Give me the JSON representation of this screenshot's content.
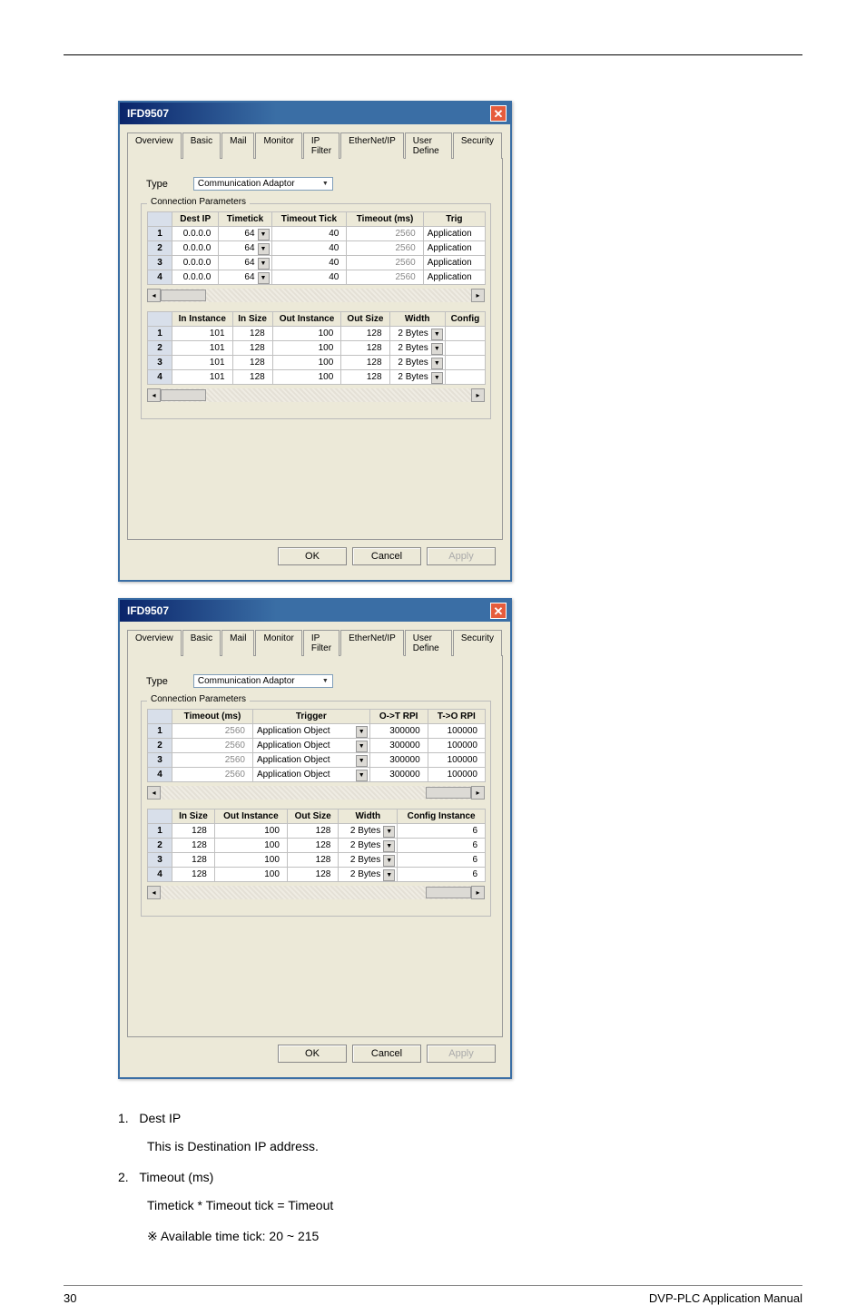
{
  "window_title": "IFD9507",
  "tabs": [
    "Overview",
    "Basic",
    "Mail",
    "Monitor",
    "IP Filter",
    "EtherNet/IP",
    "User Define",
    "Security"
  ],
  "active_tab": "EtherNet/IP",
  "type_label": "Type",
  "type_value": "Communication Adaptor",
  "group_label": "Connection Parameters",
  "dialog1": {
    "table1": {
      "headers": [
        "Dest IP",
        "Timetick",
        "Timeout Tick",
        "Timeout (ms)",
        "Trig"
      ],
      "rows": [
        {
          "n": "1",
          "dest": "0.0.0.0",
          "tt": "64",
          "ttk": "40",
          "toms": "2560",
          "trig": "Application"
        },
        {
          "n": "2",
          "dest": "0.0.0.0",
          "tt": "64",
          "ttk": "40",
          "toms": "2560",
          "trig": "Application"
        },
        {
          "n": "3",
          "dest": "0.0.0.0",
          "tt": "64",
          "ttk": "40",
          "toms": "2560",
          "trig": "Application"
        },
        {
          "n": "4",
          "dest": "0.0.0.0",
          "tt": "64",
          "ttk": "40",
          "toms": "2560",
          "trig": "Application"
        }
      ]
    },
    "table2": {
      "headers": [
        "In Instance",
        "In Size",
        "Out Instance",
        "Out Size",
        "Width",
        "Config"
      ],
      "rows": [
        {
          "n": "1",
          "ii": "101",
          "is": "128",
          "oi": "100",
          "os": "128",
          "w": "2 Bytes",
          "c": ""
        },
        {
          "n": "2",
          "ii": "101",
          "is": "128",
          "oi": "100",
          "os": "128",
          "w": "2 Bytes",
          "c": ""
        },
        {
          "n": "3",
          "ii": "101",
          "is": "128",
          "oi": "100",
          "os": "128",
          "w": "2 Bytes",
          "c": ""
        },
        {
          "n": "4",
          "ii": "101",
          "is": "128",
          "oi": "100",
          "os": "128",
          "w": "2 Bytes",
          "c": ""
        }
      ]
    }
  },
  "dialog2": {
    "table1": {
      "headers": [
        "Timeout (ms)",
        "Trigger",
        "O->T RPI",
        "T->O RPI"
      ],
      "rows": [
        {
          "n": "1",
          "toms": "2560",
          "trig": "Application Object",
          "ot": "300000",
          "to": "100000"
        },
        {
          "n": "2",
          "toms": "2560",
          "trig": "Application Object",
          "ot": "300000",
          "to": "100000"
        },
        {
          "n": "3",
          "toms": "2560",
          "trig": "Application Object",
          "ot": "300000",
          "to": "100000"
        },
        {
          "n": "4",
          "toms": "2560",
          "trig": "Application Object",
          "ot": "300000",
          "to": "100000"
        }
      ]
    },
    "table2": {
      "headers": [
        "In Size",
        "Out Instance",
        "Out Size",
        "Width",
        "Config Instance"
      ],
      "rows": [
        {
          "n": "1",
          "is": "128",
          "oi": "100",
          "os": "128",
          "w": "2 Bytes",
          "ci": "6"
        },
        {
          "n": "2",
          "is": "128",
          "oi": "100",
          "os": "128",
          "w": "2 Bytes",
          "ci": "6"
        },
        {
          "n": "3",
          "is": "128",
          "oi": "100",
          "os": "128",
          "w": "2 Bytes",
          "ci": "6"
        },
        {
          "n": "4",
          "is": "128",
          "oi": "100",
          "os": "128",
          "w": "2 Bytes",
          "ci": "6"
        }
      ]
    }
  },
  "buttons": {
    "ok": "OK",
    "cancel": "Cancel",
    "apply": "Apply"
  },
  "doc": {
    "i1_t": "Dest IP",
    "i1_d": "This is Destination IP address.",
    "i2_t": "Timeout (ms)",
    "i2_d1": "Timetick * Timeout tick = Timeout",
    "i2_d2": "※  Available time tick: 20 ~ 215"
  },
  "footer": {
    "page": "30",
    "manual": "DVP-PLC Application Manual"
  }
}
